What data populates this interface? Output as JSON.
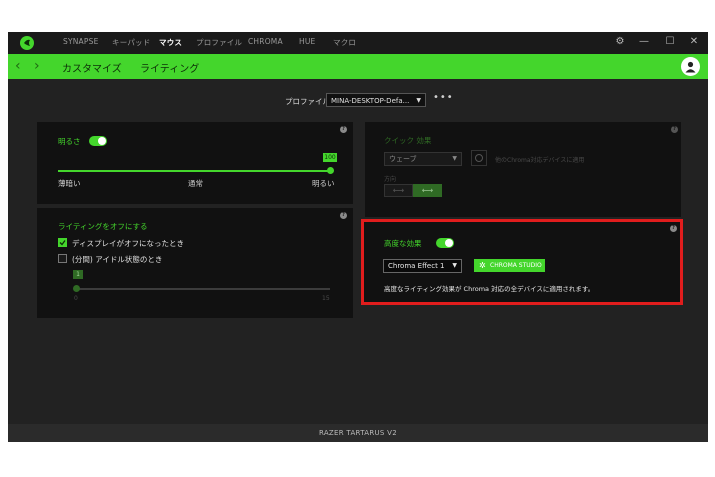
{
  "nav": {
    "tabs": [
      {
        "label": "SYNAPSE",
        "active": false
      },
      {
        "label": "キーパッド",
        "active": false
      },
      {
        "label": "マウス",
        "active": true
      },
      {
        "label": "プロファイル",
        "active": false
      },
      {
        "label": "CHROMA",
        "active": false
      },
      {
        "label": "HUE",
        "active": false
      },
      {
        "label": "マクロ",
        "active": false
      }
    ]
  },
  "subnav": {
    "tabs": [
      "カスタマイズ",
      "ライティング"
    ]
  },
  "profile": {
    "label": "プロファイル",
    "value": "MINA-DESKTOP-Defa..."
  },
  "brightness": {
    "title": "明るさ",
    "value": "100",
    "level": 100,
    "labels": [
      "薄暗い",
      "通常",
      "明るい"
    ]
  },
  "lighting_off": {
    "title": "ライティングをオフにする",
    "option1": "ディスプレイがオフになったとき",
    "option2": "(分間) アイドル状態のとき",
    "slider_value": "1",
    "slider_min": "0",
    "slider_max": "15"
  },
  "quick_effect": {
    "title": "クイック 効果",
    "value": "ウェーブ",
    "apply_all": "他のChroma対応デバイスに適用",
    "direction_label": "方向"
  },
  "advanced": {
    "title": "高度な効果",
    "effect_value": "Chroma Effect 1",
    "studio_button": "CHROMA STUDIO",
    "description": "高度なライティング効果が Chroma 対応の全デバイスに適用されます。"
  },
  "footer": {
    "device": "RAZER TARTARUS V2"
  },
  "colors": {
    "accent": "#44d62c",
    "highlight": "#e11d1d"
  }
}
